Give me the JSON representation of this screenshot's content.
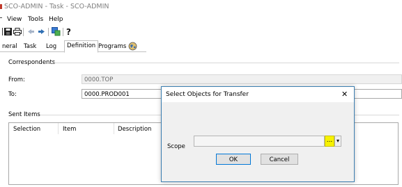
{
  "window": {
    "title": "SCO-ADMIN - Task - SCO-ADMIN"
  },
  "menu": [
    {
      "label": "View"
    },
    {
      "label": "Tools"
    },
    {
      "label": "Help"
    }
  ],
  "toolbar": {
    "icons": [
      "save-icon",
      "print-icon",
      "back-arrow-icon",
      "forward-arrow-icon",
      "transfer-icon",
      "help-icon"
    ]
  },
  "tabs": [
    {
      "label": "neral",
      "active": false
    },
    {
      "label": "Task",
      "active": false
    },
    {
      "label": "Log",
      "active": false
    },
    {
      "label": "Definition",
      "active": true
    },
    {
      "label": "Programs",
      "active": false
    }
  ],
  "correspondents": {
    "section_label": "Correspondents",
    "from_label": "From:",
    "from_value": "0000.TOP",
    "to_label": "To:",
    "to_value": "0000.PROD001"
  },
  "sent_items": {
    "section_label": "Sent Items",
    "columns": [
      "Selection",
      "Item",
      "Description"
    ]
  },
  "dialog": {
    "title": "Select Objects for Transfer",
    "close_glyph": "✕",
    "scope_label": "Scope",
    "scope_value": "",
    "browse_label": "...",
    "dropdown_glyph": "▾",
    "ok_label": "OK",
    "cancel_label": "Cancel"
  },
  "colors": {
    "browse_highlight": "#f7f200",
    "dialog_border": "#3c7fb1",
    "default_button_border": "#0078d7"
  }
}
